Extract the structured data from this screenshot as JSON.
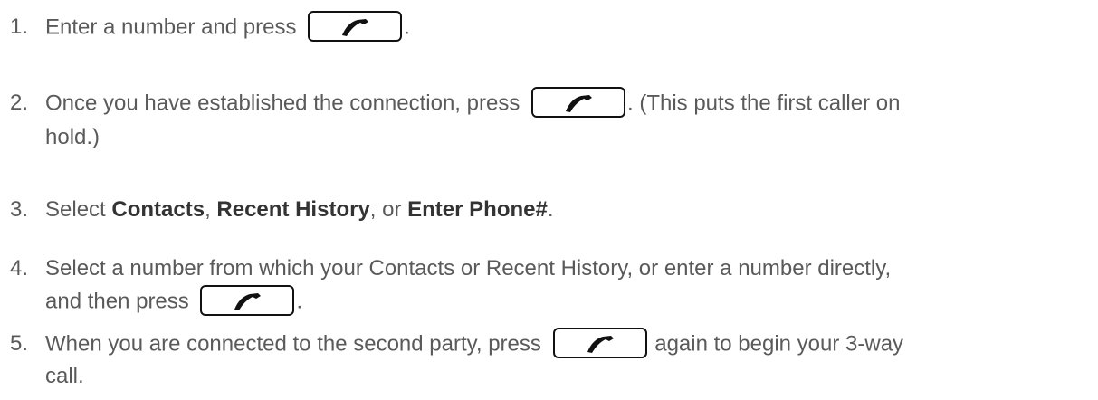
{
  "steps": [
    {
      "number": "1.",
      "before_key": "Enter a number and press ",
      "after_key": "."
    },
    {
      "number": "2.",
      "before_key": "Once you have established the connection, press ",
      "after_key": ". (This puts the first caller on",
      "continuation": "hold.)"
    },
    {
      "number": "3.",
      "text_a": "Select ",
      "bold_a": "Contacts",
      "text_b": ", ",
      "bold_b": "Recent History",
      "text_c": ", or ",
      "bold_c": "Enter Phone#",
      "text_d": "."
    },
    {
      "number": "4.",
      "line1": "Select a number from which your Contacts or Recent History, or enter a number directly,",
      "before_key": "and then press ",
      "after_key": "."
    },
    {
      "number": "5.",
      "before_key": "When you are connected to the second party, press ",
      "after_key": " again to begin your 3-way",
      "continuation": "call."
    }
  ],
  "key_icon": "talk-phone-icon"
}
